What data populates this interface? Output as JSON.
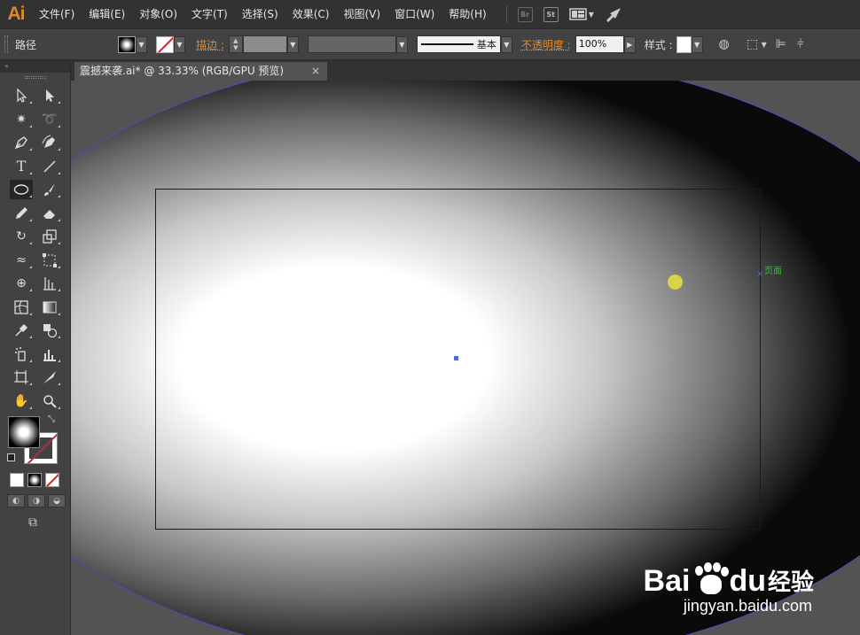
{
  "app": {
    "logo": "Ai"
  },
  "menu": [
    "文件(F)",
    "编辑(E)",
    "对象(O)",
    "文字(T)",
    "选择(S)",
    "效果(C)",
    "视图(V)",
    "窗口(W)",
    "帮助(H)"
  ],
  "menu_extras": {
    "bridge": "Br",
    "stock": "St"
  },
  "control_bar": {
    "selection_type": "路径",
    "stroke_label": "描边 :",
    "stroke_style": "基本",
    "opacity_label": "不透明度 :",
    "opacity_value": "100%",
    "style_label": "样式 :"
  },
  "toolbar": {
    "collapse": "«"
  },
  "document": {
    "tab_title": "震撼来袭.ai* @ 33.33% (RGB/GPU 预览)",
    "close": "×"
  },
  "canvas": {
    "smart_guide_label": "页面",
    "anchor_glyph": "×",
    "fill_gradient": "radial",
    "ellipse_outline_color": "#4c4cc0",
    "cursor_highlight_color": "#e6e03c"
  },
  "watermark": {
    "brand_left": "Bai",
    "brand_right": "du",
    "product": "经验",
    "url": "jingyan.baidu.com"
  }
}
